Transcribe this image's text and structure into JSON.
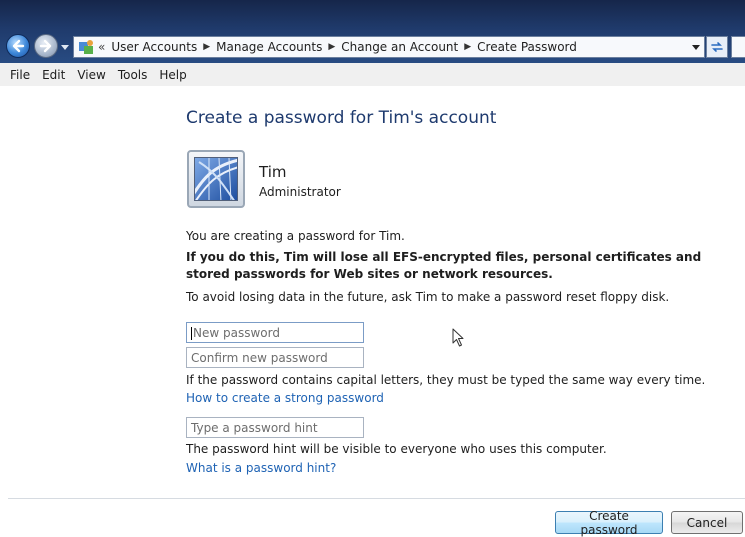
{
  "breadcrumb": {
    "overflow": "«",
    "items": [
      "User Accounts",
      "Manage Accounts",
      "Change an Account",
      "Create Password"
    ]
  },
  "menu": [
    "File",
    "Edit",
    "View",
    "Tools",
    "Help"
  ],
  "page": {
    "title": "Create a password for Tim's account",
    "user_name": "Tim",
    "user_role": "Administrator",
    "intro": "You are creating a password for Tim.",
    "warning": "If you do this, Tim will lose all EFS-encrypted files, personal certificates and stored passwords for Web sites or network resources.",
    "advice": "To avoid losing data in the future, ask Tim to make a password reset floppy disk.",
    "new_password_placeholder": "New password",
    "confirm_password_placeholder": "Confirm new password",
    "caps_note": "If the password contains capital letters, they must be typed the same way every time.",
    "strong_link": "How to create a strong password",
    "hint_placeholder": "Type a password hint",
    "hint_note": "The password hint will be visible to everyone who uses this computer.",
    "hint_link": "What is a password hint?"
  },
  "buttons": {
    "create": "Create password",
    "cancel": "Cancel"
  },
  "icons": [
    "back-arrow-icon",
    "forward-arrow-icon",
    "control-panel-icon",
    "refresh-icon",
    "user-picture-icon",
    "mouse-cursor-icon"
  ],
  "colors": {
    "title": "#1e3a6e",
    "link": "#1f63b4",
    "titlebar": "#1f3a6b"
  }
}
